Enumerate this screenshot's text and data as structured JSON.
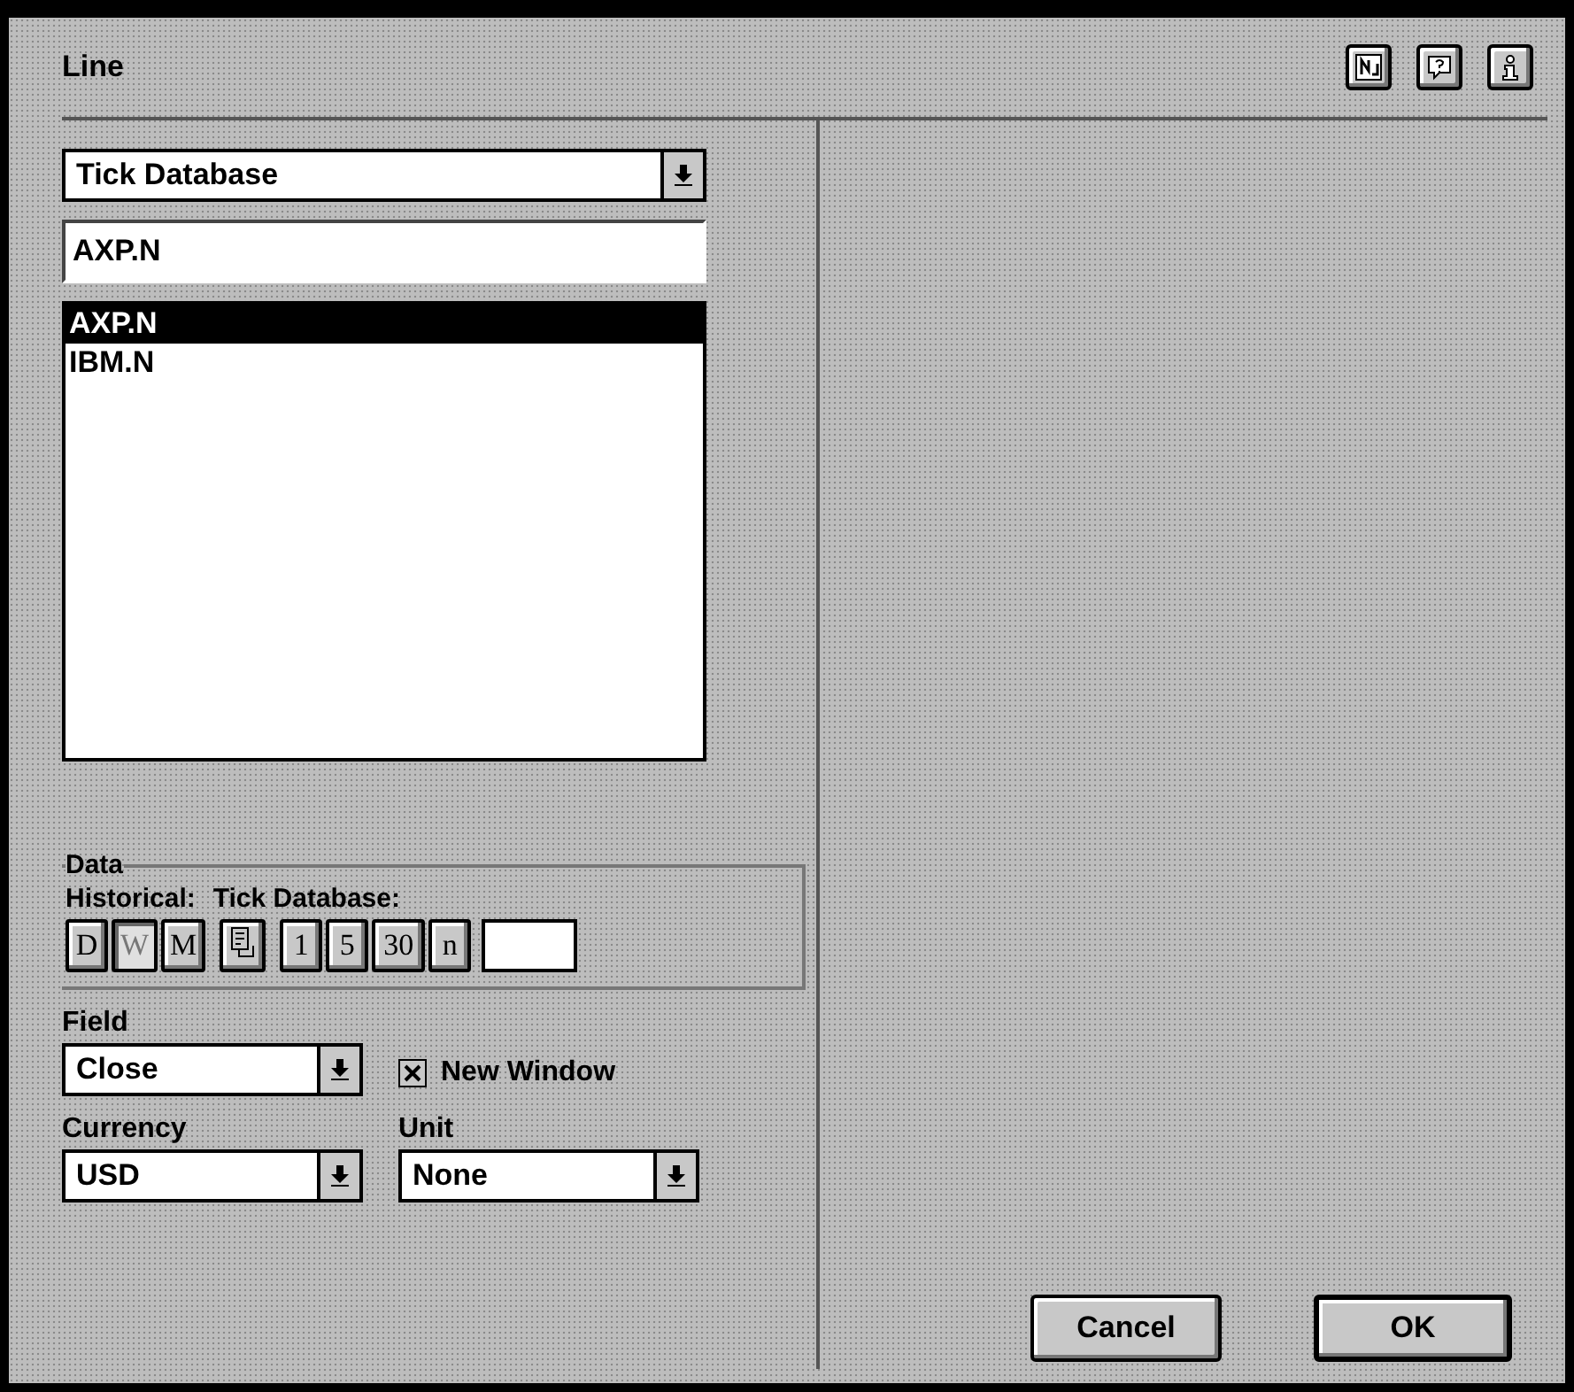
{
  "title": "Line",
  "source_select": {
    "value": "Tick Database"
  },
  "symbol_field": {
    "value": "AXP.N"
  },
  "symbol_list": [
    {
      "label": "AXP.N",
      "selected": true
    },
    {
      "label": "IBM.N",
      "selected": false
    }
  ],
  "data_group": {
    "title": "Data",
    "historical_label": "Historical:",
    "tick_label": "Tick Database:",
    "buttons": [
      {
        "kind": "text",
        "label": "D",
        "disabled": false
      },
      {
        "kind": "text",
        "label": "W",
        "disabled": true
      },
      {
        "kind": "text",
        "label": "M",
        "disabled": false
      },
      {
        "kind": "icon",
        "disabled": false
      },
      {
        "kind": "text",
        "label": "1",
        "disabled": false
      },
      {
        "kind": "text",
        "label": "5",
        "disabled": false
      },
      {
        "kind": "text",
        "label": "30",
        "disabled": false
      },
      {
        "kind": "text",
        "label": "n",
        "disabled": false
      }
    ]
  },
  "field": {
    "label": "Field",
    "value": "Close"
  },
  "new_window": {
    "label": "New Window",
    "checked": true
  },
  "currency": {
    "label": "Currency",
    "value": "USD"
  },
  "unit": {
    "label": "Unit",
    "value": "None"
  },
  "buttons": [
    {
      "label": "Cancel",
      "default": false
    },
    {
      "label": "OK",
      "default": true
    }
  ]
}
